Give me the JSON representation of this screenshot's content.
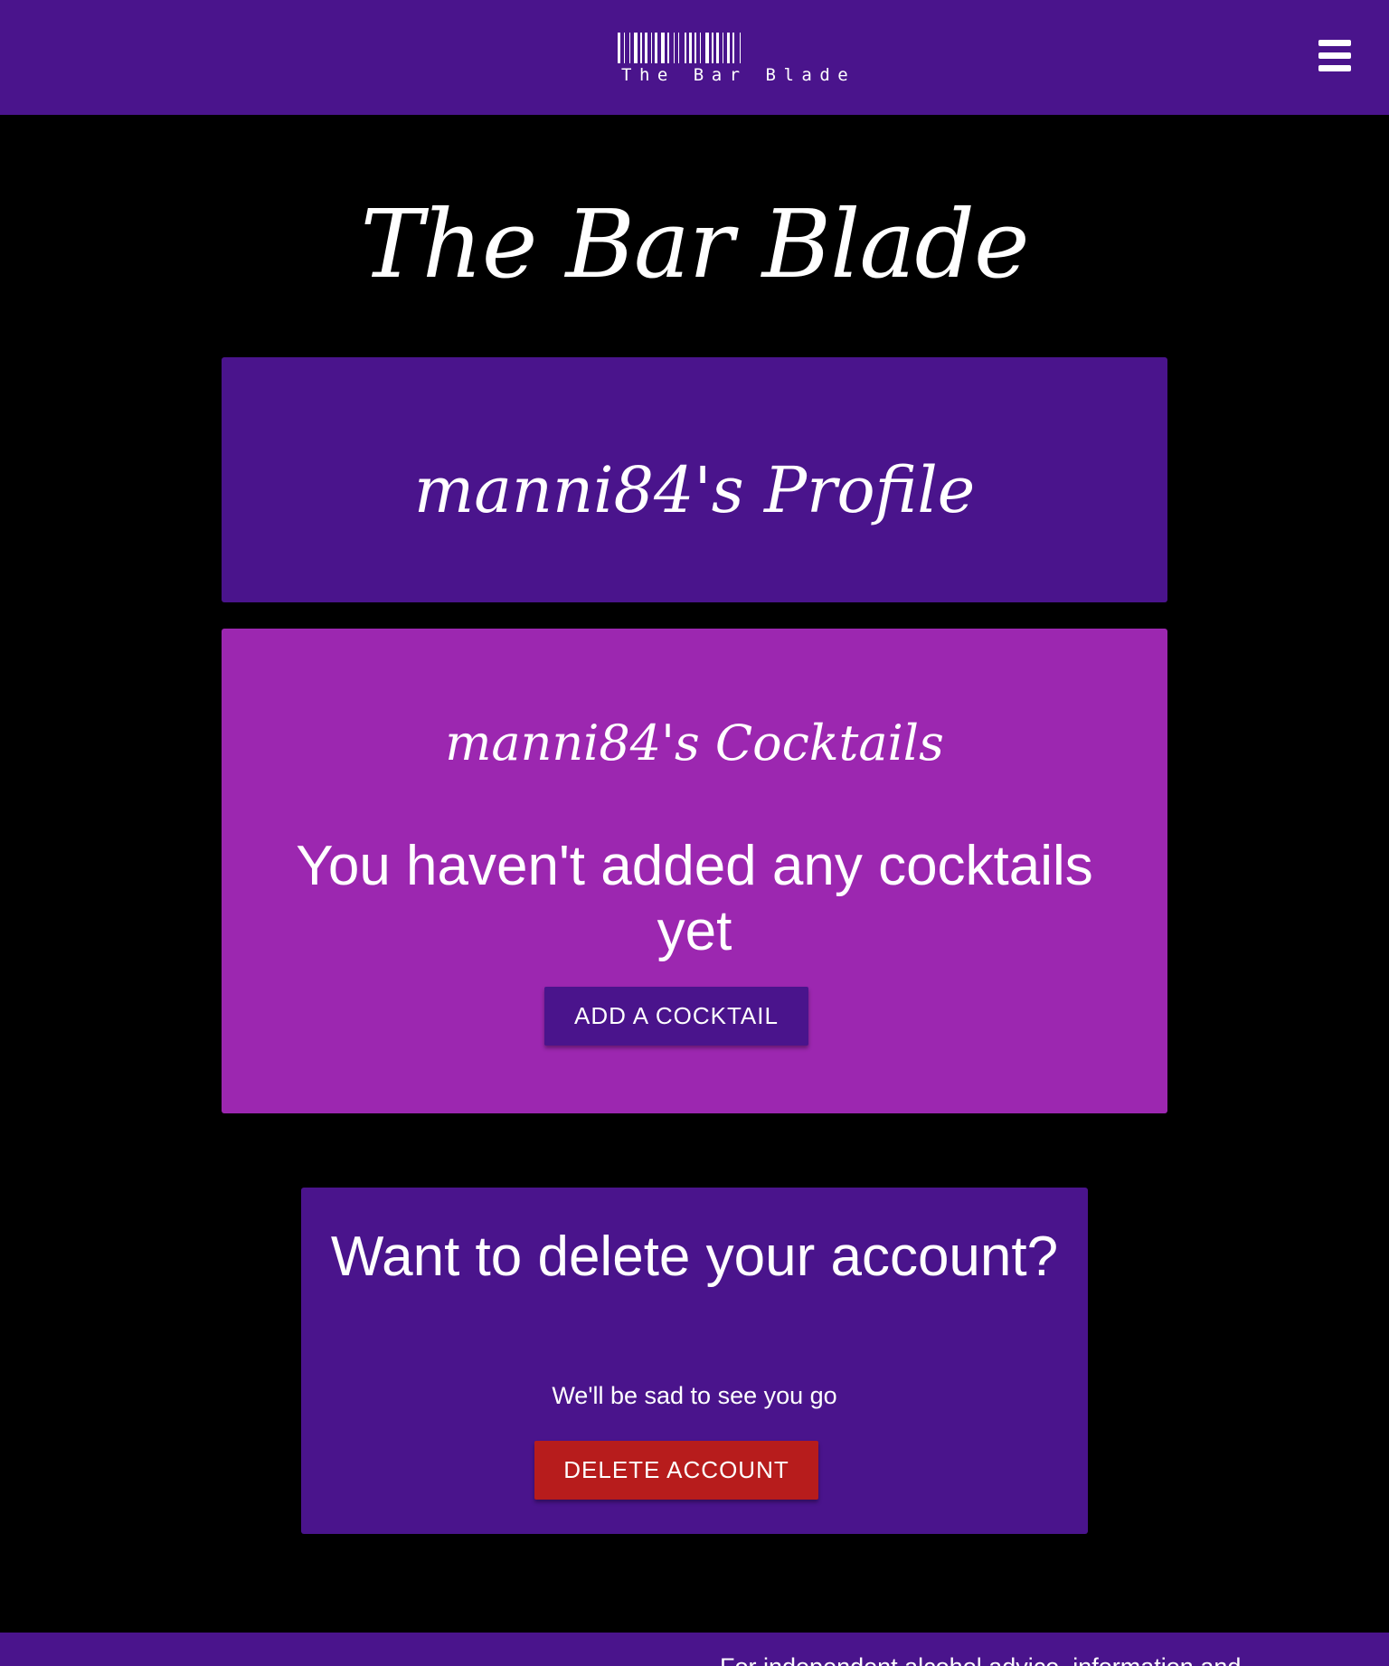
{
  "navbar": {
    "logo_text": "The Bar Blade",
    "menu_icon": "hamburger-menu-icon",
    "background": "#4a148c"
  },
  "page_title": "The Bar Blade",
  "profile": {
    "title": "manni84's Profile",
    "background": "#4a148c"
  },
  "cocktails": {
    "title": "manni84's Cocktails",
    "empty_message": "You haven't added any cocktails yet",
    "add_button_label": "ADD A COCKTAIL",
    "background": "#9c27b0"
  },
  "delete_account": {
    "title": "Want to delete your account?",
    "subtitle": "We'll be sad to see you go",
    "button_label": "DELETE ACCOUNT",
    "button_color": "#b71c1c"
  },
  "footer": {
    "text": "For independent alcohol advice, information and"
  }
}
